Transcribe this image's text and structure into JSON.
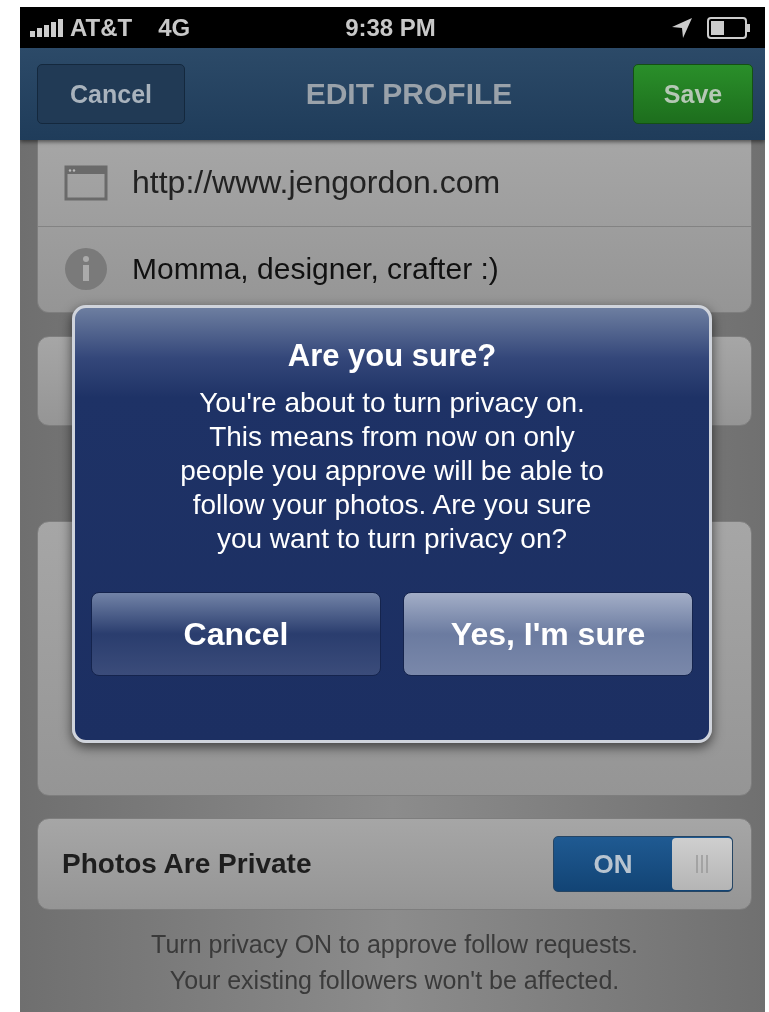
{
  "status_bar": {
    "carrier": "AT&T",
    "network": "4G",
    "time": "9:38 PM"
  },
  "nav_bar": {
    "left_button": "Cancel",
    "title": "EDIT PROFILE",
    "right_button": "Save"
  },
  "profile_fields": [
    {
      "kind": "website",
      "value": "http://www.jengordon.com"
    },
    {
      "kind": "bio",
      "value": "Momma, designer, crafter :)"
    }
  ],
  "privacy": {
    "label": "Photos Are Private",
    "toggle": {
      "on": true,
      "label": "ON"
    },
    "note": "Turn privacy ON to approve follow requests.\nYour existing followers won't be affected."
  },
  "alert": {
    "title": "Are you sure?",
    "message": "You're about to turn privacy on.\nThis means from now on only\npeople you approve will be able to\nfollow your photos. Are you sure\nyou want to turn privacy on?",
    "buttons": [
      "Cancel",
      "Yes, I'm sure"
    ]
  }
}
